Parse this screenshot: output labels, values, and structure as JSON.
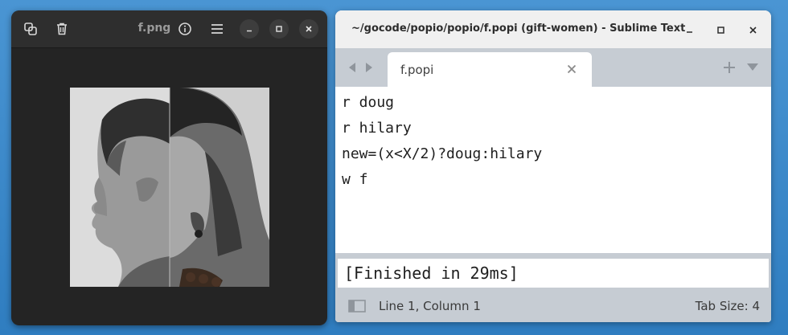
{
  "viewer": {
    "title": "f.png",
    "toolbar_icons": [
      "copy-icon",
      "trash-icon"
    ],
    "header_icons": [
      "info-icon",
      "hamburger-menu-icon"
    ],
    "window_controls": [
      "minimize-icon",
      "maximize-icon",
      "close-icon"
    ],
    "image": "half-and-half portrait of two faces in profile (black and white)"
  },
  "sublime": {
    "title": "~/gocode/popio/popio/f.popi (gift-women) - Sublime Text",
    "window_controls": [
      "minimize-icon",
      "maximize-icon",
      "close-icon"
    ],
    "tab": {
      "label": "f.popi"
    },
    "code_lines": [
      "r doug",
      "r hilary",
      "new=(x<X/2)?doug:hilary",
      "w f"
    ],
    "output": "[Finished in 29ms]",
    "status": {
      "position": "Line 1, Column 1",
      "tab_size": "Tab Size: 4"
    }
  },
  "colors": {
    "desktop": "#3b87c7",
    "viewer_bg": "#242424",
    "sublime_chrome": "#c6ccd3"
  }
}
